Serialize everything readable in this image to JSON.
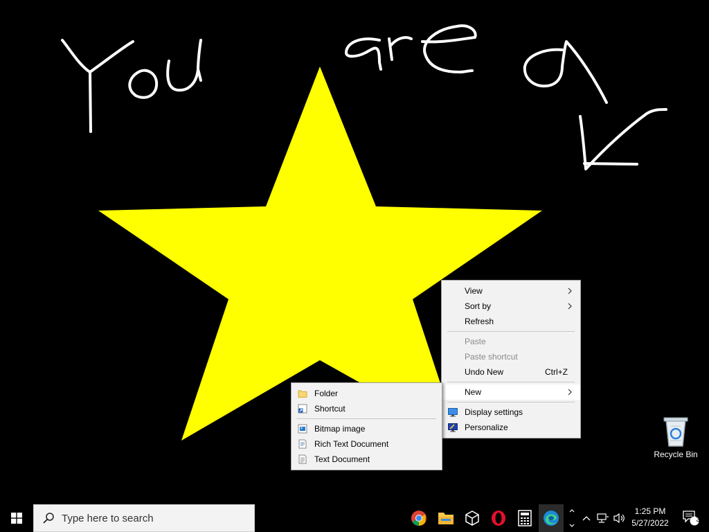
{
  "wallpaper": {
    "star_color": "#ffff00",
    "handwriting_color": "#ffffff",
    "handwriting_text": "You are a"
  },
  "context_menu": {
    "items": [
      {
        "label": "View",
        "submenu": true
      },
      {
        "label": "Sort by",
        "submenu": true
      },
      {
        "label": "Refresh"
      },
      {
        "label": "Paste",
        "disabled": true
      },
      {
        "label": "Paste shortcut",
        "disabled": true
      },
      {
        "label": "Undo New",
        "shortcut": "Ctrl+Z"
      },
      {
        "label": "New",
        "submenu": true,
        "highlighted": true
      },
      {
        "label": "Display settings",
        "icon": "display-settings-icon"
      },
      {
        "label": "Personalize",
        "icon": "personalize-icon"
      }
    ]
  },
  "new_submenu": {
    "items": [
      {
        "label": "Folder",
        "icon": "folder-icon"
      },
      {
        "label": "Shortcut",
        "icon": "shortcut-icon"
      },
      {
        "label": "Bitmap image",
        "icon": "bitmap-icon"
      },
      {
        "label": "Rich Text Document",
        "icon": "rich-text-icon"
      },
      {
        "label": "Text Document",
        "icon": "text-document-icon"
      }
    ]
  },
  "desktop_icons": [
    {
      "label": "Recycle Bin",
      "icon": "recycle-bin-icon"
    }
  ],
  "taskbar": {
    "search_placeholder": "Type here to search",
    "apps": [
      "chrome-icon",
      "file-explorer-icon",
      "3d-viewer-icon",
      "opera-icon",
      "calculator-icon",
      "edge-icon"
    ],
    "clock_time": "1:25 PM",
    "clock_date": "5/27/2022",
    "notification_count": "3"
  }
}
